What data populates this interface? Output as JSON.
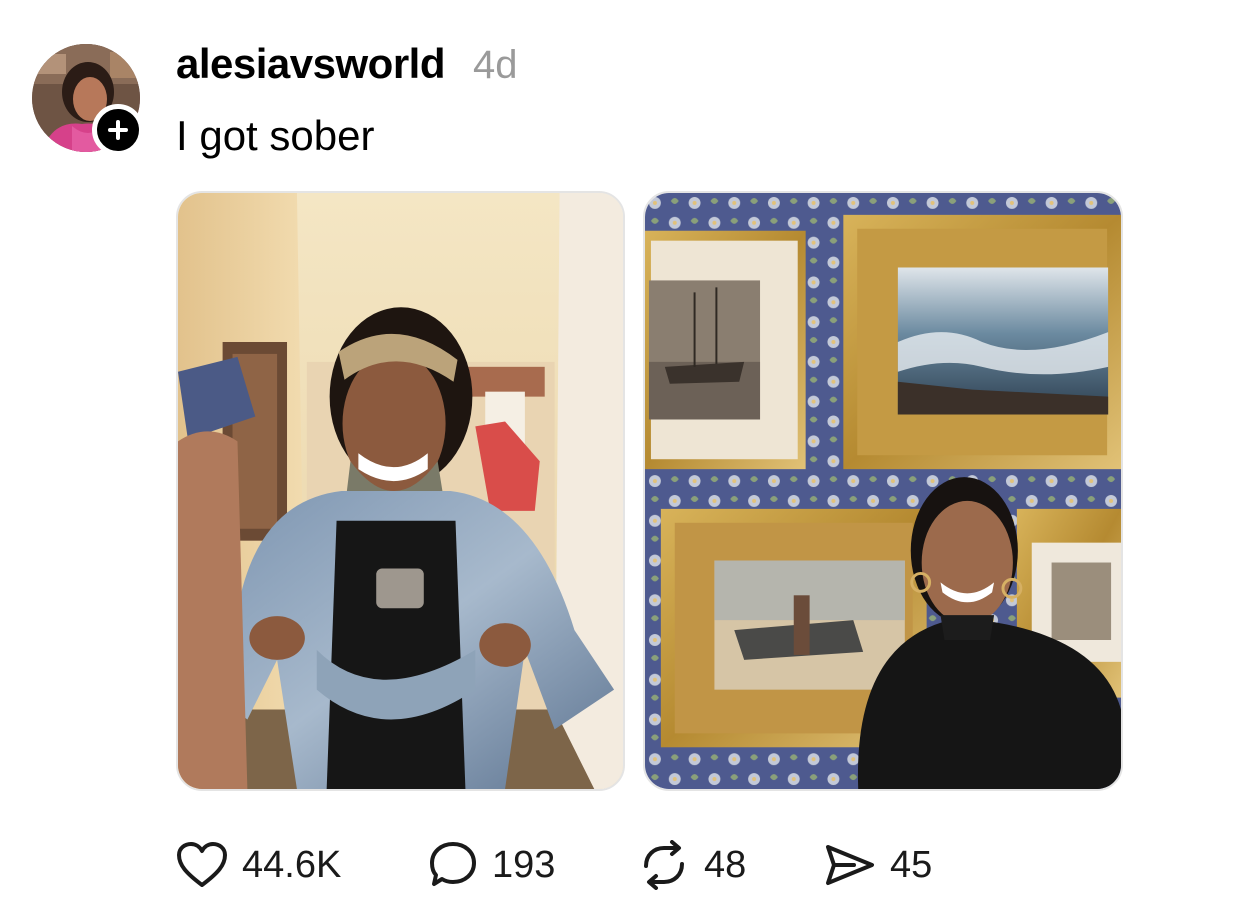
{
  "post": {
    "username": "alesiavsworld",
    "timestamp": "4d",
    "text": "I got sober",
    "avatar_icon": "profile-avatar",
    "follow_icon": "plus-icon",
    "photos": [
      {
        "icon": "photo-woman-denim-jacket"
      },
      {
        "icon": "photo-woman-gallery-wall"
      }
    ],
    "actions": {
      "likes": "44.6K",
      "comments": "193",
      "reposts": "48",
      "shares": "45"
    }
  },
  "colors": {
    "text": "#000000",
    "muted": "#9a9a9a",
    "background": "#ffffff"
  }
}
